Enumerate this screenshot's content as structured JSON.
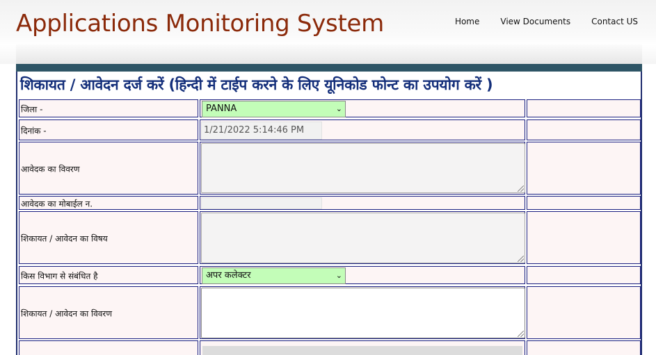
{
  "header": {
    "app_title": "Applications Monitoring System",
    "nav": [
      "Home",
      "View Documents",
      "Contact US"
    ]
  },
  "form": {
    "title": "शिकायत / आवेदन दर्ज करें (हिन्दी में टाईप करने के लिए यूनिकोड फोन्ट का उपयोग करें )",
    "district_label": "जिला -",
    "district_value": "PANNA",
    "date_label": "दिनांक -",
    "date_value": "1/21/2022 5:14:46 PM",
    "applicant_details_label": "आवेदक का विवरण",
    "mobile_label": "आवेदक का मोबाईल न.",
    "subject_label": "शिकायत / आवेदन का विषय",
    "department_label": "किस विभाग से संबंधित है",
    "department_value": "अपर कलेक्टर",
    "complaint_details_label": "शिकायत / आवेदन का विवरण"
  }
}
